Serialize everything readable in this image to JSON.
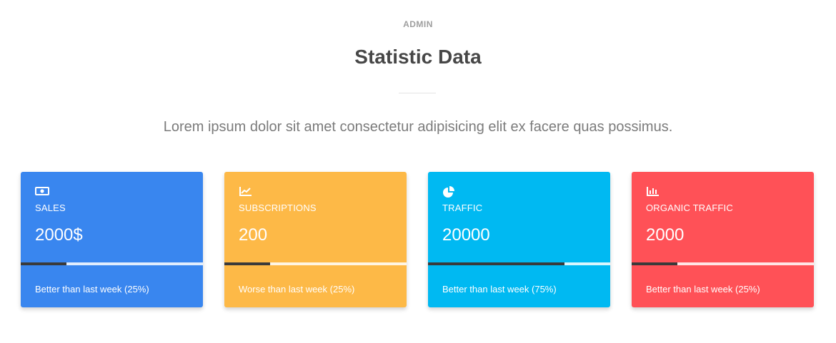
{
  "header": {
    "eyebrow": "ADMIN",
    "title": "Statistic Data",
    "subtitle": "Lorem ipsum dolor sit amet consectetur adipisicing elit ex facere quas possimus."
  },
  "cards": [
    {
      "icon": "money-icon",
      "label": "SALES",
      "value": "2000$",
      "progress": 0.25,
      "note": "Better than last week (25%)",
      "color": "#3986ef"
    },
    {
      "icon": "trending-chart-icon",
      "label": "SUBSCRIPTIONS",
      "value": "200",
      "progress": 0.25,
      "note": "Worse than last week (25%)",
      "color": "#fdb947"
    },
    {
      "icon": "pie-chart-icon",
      "label": "TRAFFIC",
      "value": "20000",
      "progress": 0.75,
      "note": "Better than last week (75%)",
      "color": "#00b9f2"
    },
    {
      "icon": "bar-chart-icon",
      "label": "ORGANIC TRAFFIC",
      "value": "2000",
      "progress": 0.25,
      "note": "Better than last week (25%)",
      "color": "#ff5157"
    }
  ]
}
